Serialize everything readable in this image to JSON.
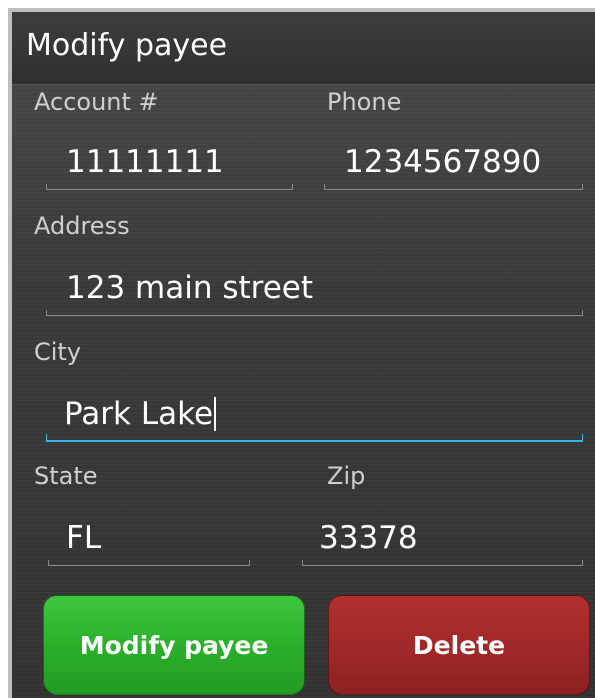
{
  "dialog": {
    "title": "Modify payee"
  },
  "form": {
    "account": {
      "label": "Account #",
      "value": "11111111"
    },
    "phone": {
      "label": "Phone",
      "value": "1234567890"
    },
    "address": {
      "label": "Address",
      "value": "123 main street"
    },
    "city": {
      "label": "City",
      "value": "Park Lake",
      "focused": true
    },
    "state": {
      "label": "State",
      "value": "FL"
    },
    "zip": {
      "label": "Zip",
      "value": "33378"
    }
  },
  "buttons": {
    "modify_label": "Modify payee",
    "delete_label": "Delete"
  },
  "colors": {
    "focus_underline": "#33b5e5",
    "modify_button": "#2aae2a",
    "delete_button": "#a02828"
  }
}
